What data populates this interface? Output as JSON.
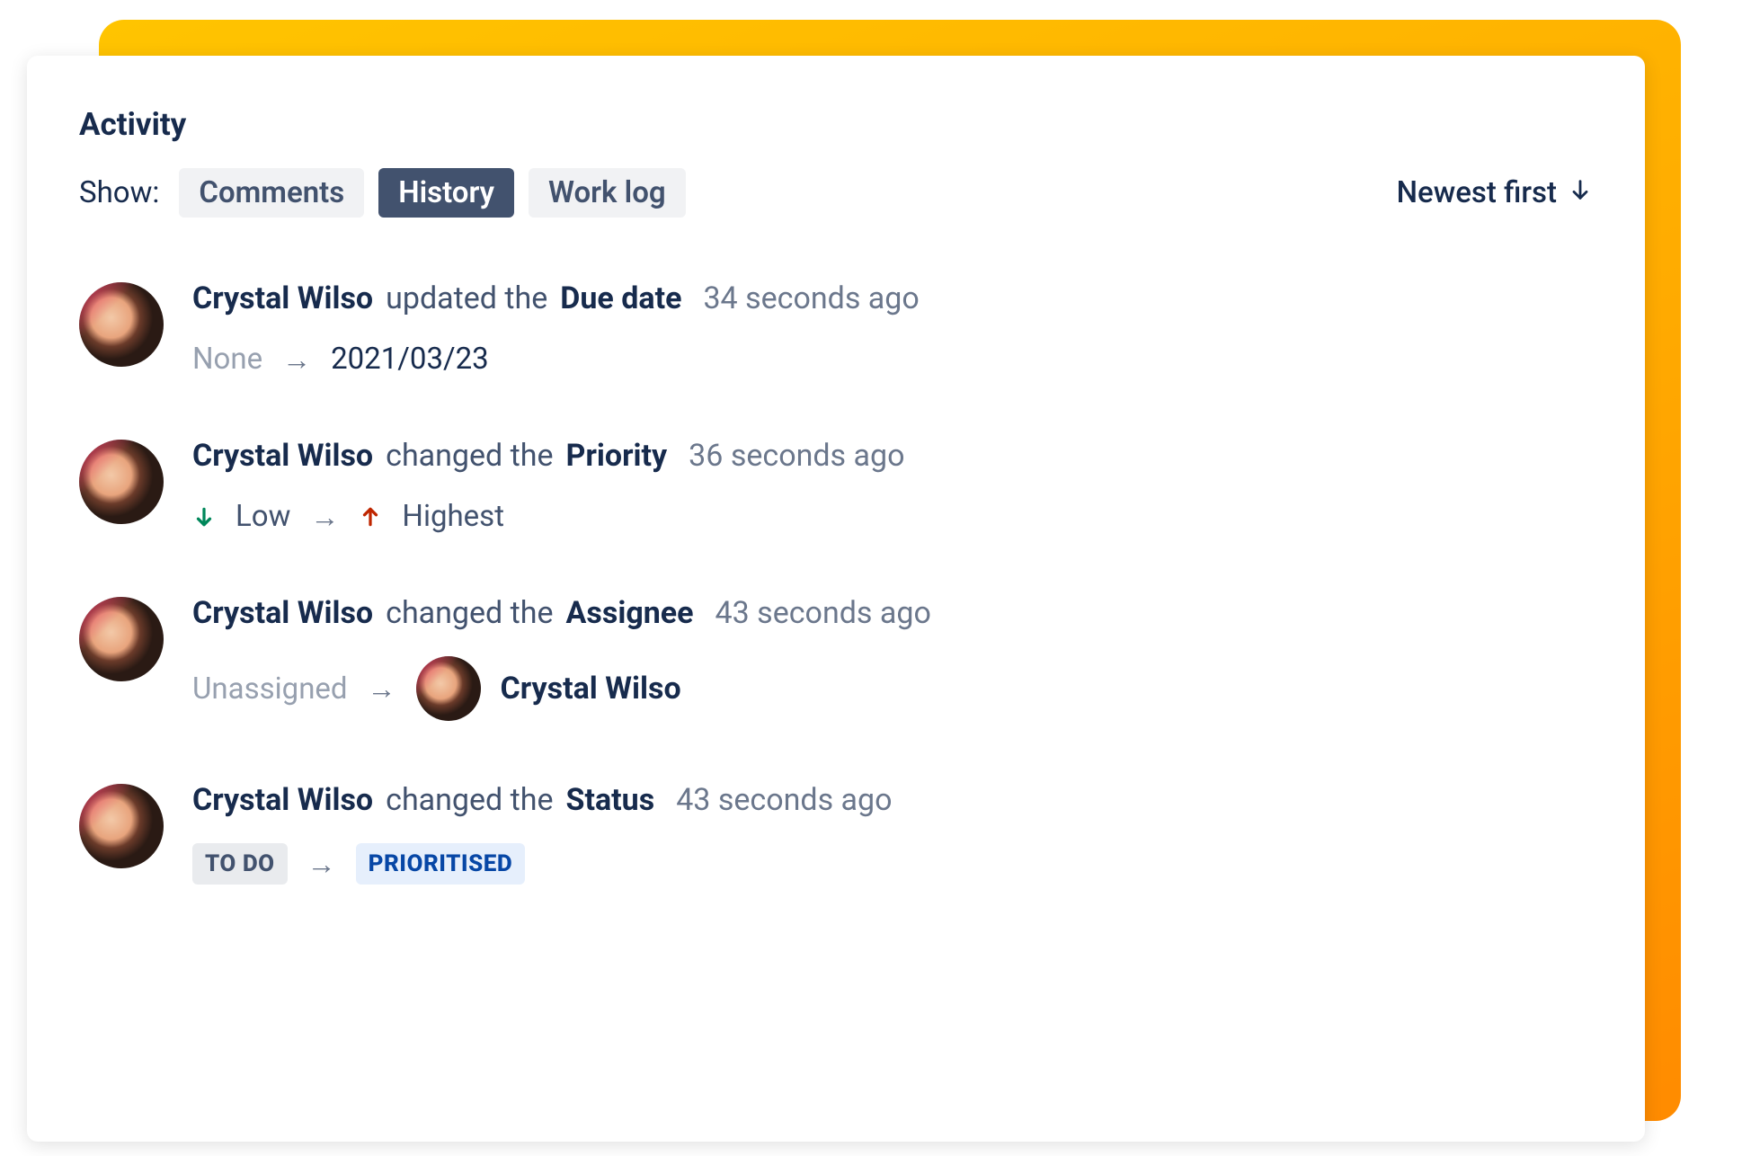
{
  "section_title": "Activity",
  "show_label": "Show:",
  "tabs": {
    "comments": "Comments",
    "history": "History",
    "worklog": "Work log",
    "active": "history"
  },
  "sort": {
    "label": "Newest first"
  },
  "actor": {
    "name": "Crystal Wilso"
  },
  "entries": [
    {
      "verb": "updated the",
      "field": "Due date",
      "time": "34 seconds ago",
      "from_text": "None",
      "to_text": "2021/03/23",
      "kind": "text"
    },
    {
      "verb": "changed the",
      "field": "Priority",
      "time": "36 seconds ago",
      "from_text": "Low",
      "to_text": "Highest",
      "kind": "priority"
    },
    {
      "verb": "changed the",
      "field": "Assignee",
      "time": "43 seconds ago",
      "from_text": "Unassigned",
      "to_text": "Crystal Wilso",
      "kind": "assignee"
    },
    {
      "verb": "changed the",
      "field": "Status",
      "time": "43 seconds ago",
      "from_text": "TO DO",
      "to_text": "PRIORITISED",
      "kind": "status"
    }
  ]
}
